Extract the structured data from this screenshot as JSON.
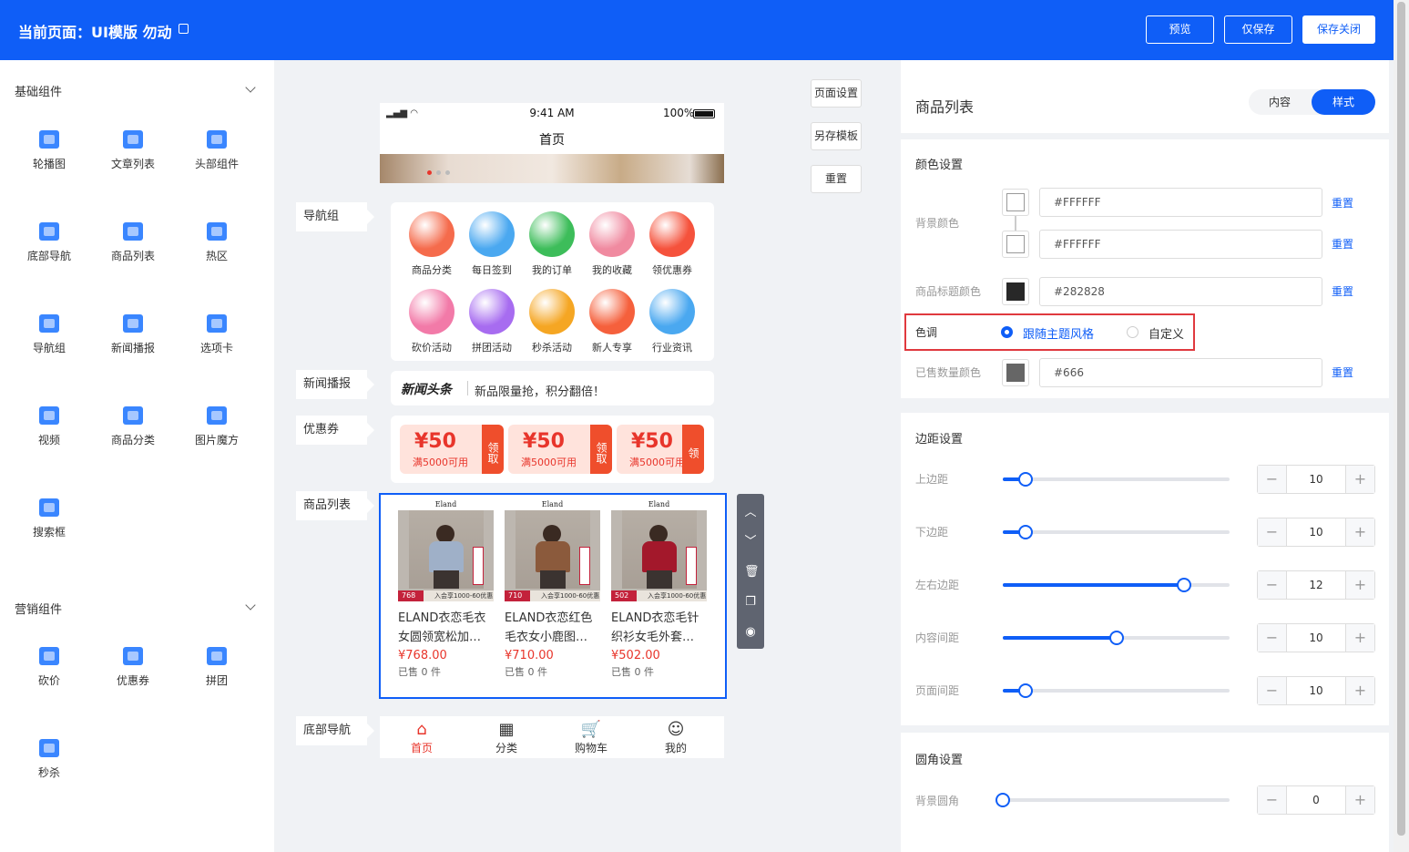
{
  "header": {
    "title": "当前页面：UI模版 勿动",
    "edit_icon": "edit-icon",
    "buttons": {
      "preview": "预览",
      "save_only": "仅保存",
      "save_close": "保存关闭"
    }
  },
  "left_panel": {
    "basic": {
      "title": "基础组件",
      "items": [
        {
          "label": "轮播图",
          "icon": "carousel-icon"
        },
        {
          "label": "文章列表",
          "icon": "article-list-icon"
        },
        {
          "label": "头部组件",
          "icon": "header-icon"
        },
        {
          "label": "底部导航",
          "icon": "bottom-nav-icon"
        },
        {
          "label": "商品列表",
          "icon": "product-list-icon"
        },
        {
          "label": "热区",
          "icon": "hotspot-icon"
        },
        {
          "label": "导航组",
          "icon": "nav-group-icon"
        },
        {
          "label": "新闻播报",
          "icon": "news-icon"
        },
        {
          "label": "选项卡",
          "icon": "tabs-icon"
        },
        {
          "label": "视频",
          "icon": "video-icon"
        },
        {
          "label": "商品分类",
          "icon": "category-icon"
        },
        {
          "label": "图片魔方",
          "icon": "image-cube-icon"
        },
        {
          "label": "搜索框",
          "icon": "search-icon"
        }
      ]
    },
    "marketing": {
      "title": "营销组件",
      "items": [
        {
          "label": "砍价",
          "icon": "bargain-icon"
        },
        {
          "label": "优惠券",
          "icon": "coupon-icon"
        },
        {
          "label": "拼团",
          "icon": "group-buy-icon"
        },
        {
          "label": "秒杀",
          "icon": "flash-sale-icon"
        }
      ]
    }
  },
  "canvas": {
    "side_buttons": {
      "page_settings": "页面设置",
      "save_template": "另存模板",
      "reset": "重置"
    },
    "tags": {
      "nav_group": "导航组",
      "news": "新闻播报",
      "coupon": "优惠券",
      "product_list": "商品列表",
      "bottom_nav": "底部导航"
    },
    "phone": {
      "status_time": "9:41 AM",
      "battery": "100%",
      "page_title": "首页"
    },
    "nav_items": [
      {
        "label": "商品分类",
        "color": "#f56b4c"
      },
      {
        "label": "每日签到",
        "color": "#4aa8f0"
      },
      {
        "label": "我的订单",
        "color": "#3dbd5a"
      },
      {
        "label": "我的收藏",
        "color": "#f08aa0"
      },
      {
        "label": "领优惠券",
        "color": "#f5523c"
      },
      {
        "label": "砍价活动",
        "color": "#f27aa8"
      },
      {
        "label": "拼团活动",
        "color": "#a76cf0"
      },
      {
        "label": "秒杀活动",
        "color": "#f5a623"
      },
      {
        "label": "新人专享",
        "color": "#f5603c"
      },
      {
        "label": "行业资讯",
        "color": "#4aa8f0"
      }
    ],
    "news": {
      "brand": "新闻头条",
      "text": "新品限量抢，积分翻倍！"
    },
    "coupons": [
      {
        "amount": "¥50",
        "condition": "满5000可用",
        "action": "领取"
      },
      {
        "amount": "¥50",
        "condition": "满5000可用",
        "action": "领取"
      },
      {
        "amount": "¥50",
        "condition": "满5000可用",
        "action": "领"
      }
    ],
    "products": [
      {
        "brand": "Eland",
        "name": "ELAND衣恋毛衣女圆领宽松加…",
        "price": "¥768.00",
        "sold": "已售 0 件",
        "badge": "768",
        "banner": "入会享1000-60优惠券",
        "coat": "#9fb0c8"
      },
      {
        "brand": "Eland",
        "name": "ELAND衣恋红色毛衣女小鹿图…",
        "price": "¥710.00",
        "sold": "已售 0 件",
        "badge": "710",
        "banner": "入会享1000-60优惠券",
        "coat": "#8b5a3c"
      },
      {
        "brand": "Eland",
        "name": "ELAND衣恋毛针织衫女毛外套…",
        "price": "¥502.00",
        "sold": "已售 0 件",
        "badge": "502",
        "banner": "入会享1000-60优惠券",
        "coat": "#a3182b"
      }
    ],
    "bottom_nav": [
      {
        "label": "首页",
        "icon": "home-icon",
        "active": true
      },
      {
        "label": "分类",
        "icon": "grid-icon",
        "active": false
      },
      {
        "label": "购物车",
        "icon": "cart-icon",
        "active": false
      },
      {
        "label": "我的",
        "icon": "user-icon",
        "active": false
      }
    ]
  },
  "right_panel": {
    "title": "商品列表",
    "tabs": {
      "content": "内容",
      "style": "样式"
    },
    "color": {
      "title": "颜色设置",
      "bg_label": "背景颜色",
      "bg1": "#FFFFFF",
      "bg2": "#FFFFFF",
      "title_color_label": "商品标题颜色",
      "title_color": "#282828",
      "tone_label": "色调",
      "tone_follow": "跟随主题风格",
      "tone_custom": "自定义",
      "sold_label": "已售数量颜色",
      "sold_color": "#666",
      "reset": "重置"
    },
    "margin": {
      "title": "边距设置",
      "items": [
        {
          "label": "上边距",
          "value": "10",
          "fraction": 0.1
        },
        {
          "label": "下边距",
          "value": "10",
          "fraction": 0.1
        },
        {
          "label": "左右边距",
          "value": "12",
          "fraction": 0.8
        },
        {
          "label": "内容间距",
          "value": "10",
          "fraction": 0.5
        },
        {
          "label": "页面间距",
          "value": "10",
          "fraction": 0.1
        }
      ]
    },
    "radius": {
      "title": "圆角设置",
      "label": "背景圆角",
      "value": "0",
      "fraction": 0
    }
  }
}
